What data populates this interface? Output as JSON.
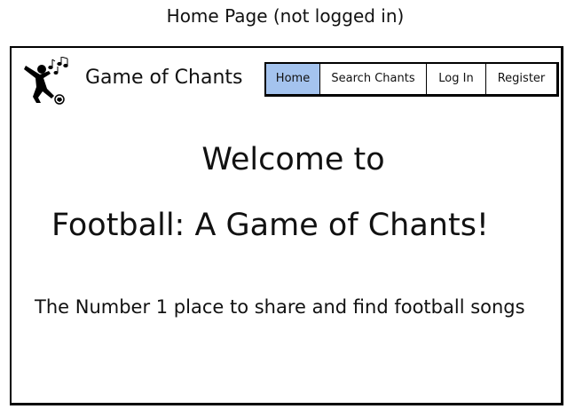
{
  "caption": "Home Page (not logged in)",
  "header": {
    "site_title": "Game of Chants",
    "logo_icon": "footballer-singing-icon"
  },
  "nav": {
    "items": [
      {
        "label": "Home",
        "active": true
      },
      {
        "label": "Search Chants",
        "active": false
      },
      {
        "label": "Log In",
        "active": false
      },
      {
        "label": "Register",
        "active": false
      }
    ]
  },
  "main": {
    "welcome_line1": "Welcome to",
    "welcome_line2": "Football: A Game of Chants!",
    "tagline": "The Number 1 place to share and find football songs"
  },
  "colors": {
    "active_tab": "#a4c3ee",
    "border": "#000000",
    "background": "#ffffff"
  }
}
